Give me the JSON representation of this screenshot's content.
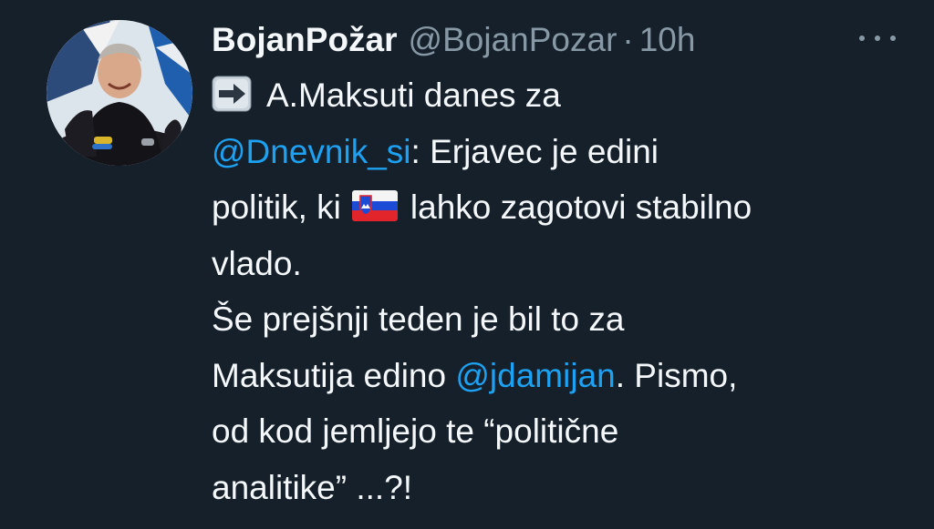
{
  "author": {
    "display_name": "BojanPožar",
    "handle": "@BojanPozar",
    "separator": "·",
    "timestamp": "10h"
  },
  "icons": {
    "more": "more-dots-icon",
    "arrow": "right-arrow-emoji-icon",
    "flag": "slovenia-flag-emoji-icon"
  },
  "colors": {
    "background": "#15202b",
    "text": "#f5f8fa",
    "secondary": "#8899a6",
    "link": "#1da1f2"
  },
  "tweet": {
    "line1_text": "A.Maksuti danes za",
    "mention1": "@Dnevnik_si",
    "line2_text": ": Erjavec je edini",
    "line3_before": "politik, ki",
    "line3_after": "lahko zagotovi stabilno",
    "line4": "vlado.",
    "line5": "Še prejšnji teden je bil to za",
    "line6_before": "Maksutija edino ",
    "mention2": "@jdamijan",
    "line6_after": ". Pismo,",
    "line7": "od kod jemljejo te “politične",
    "line8": "analitike” ...?!"
  }
}
